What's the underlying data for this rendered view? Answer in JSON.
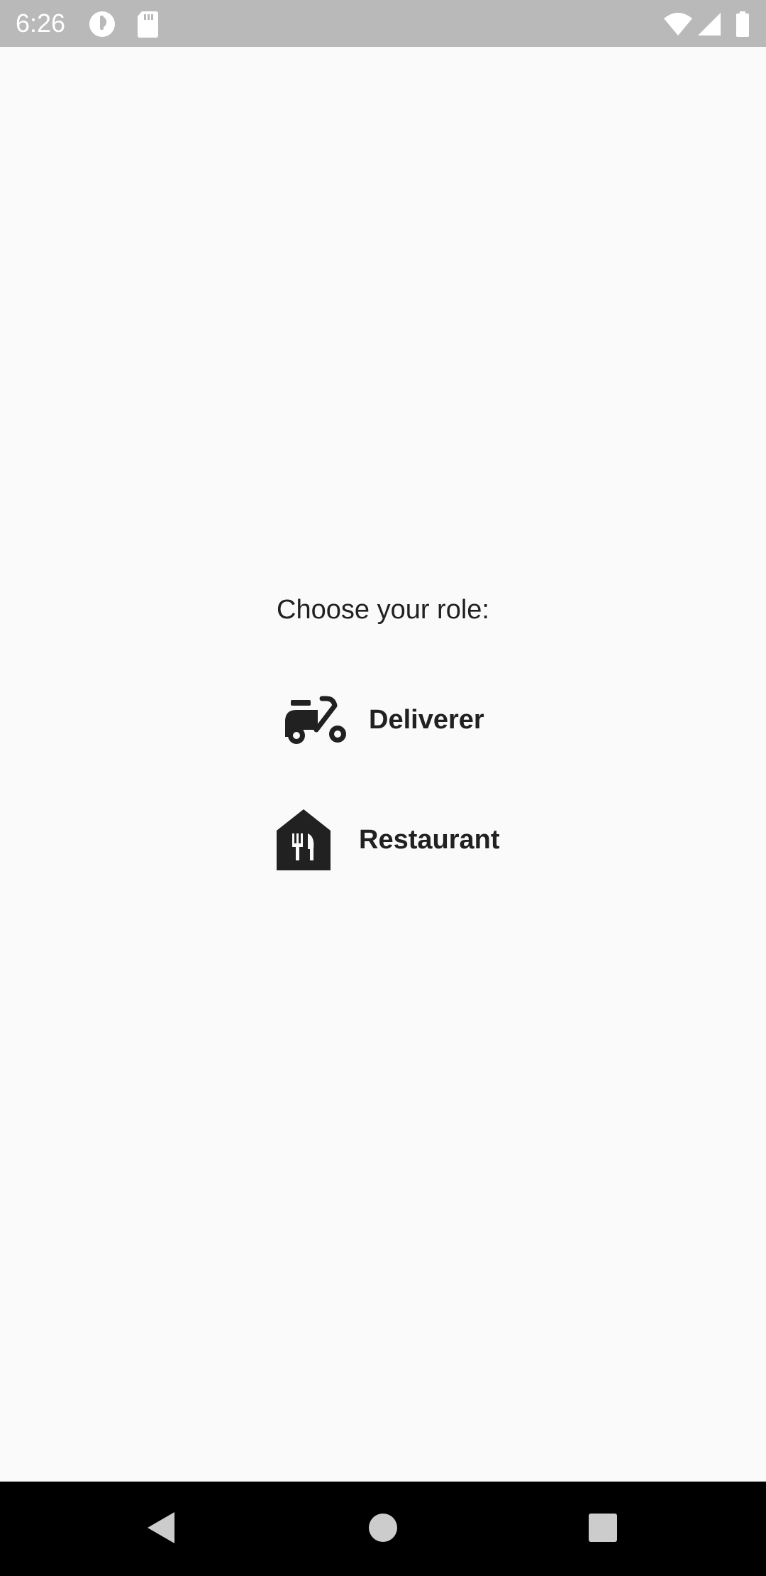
{
  "status_bar": {
    "time": "6:26",
    "left_icons": [
      "pie-chart-icon",
      "sd-card-icon"
    ],
    "right_icons": [
      "wifi-icon",
      "cell-signal-icon",
      "battery-icon"
    ],
    "background": "#b9b9b9"
  },
  "main": {
    "prompt": "Choose your role:",
    "roles": [
      {
        "label": "Deliverer",
        "icon": "scooter-icon"
      },
      {
        "label": "Restaurant",
        "icon": "restaurant-icon"
      }
    ],
    "background": "#fafafa",
    "text_color": "#212121"
  },
  "nav_bar": {
    "buttons": [
      "back-icon",
      "home-icon",
      "recents-icon"
    ],
    "background": "#000000"
  }
}
